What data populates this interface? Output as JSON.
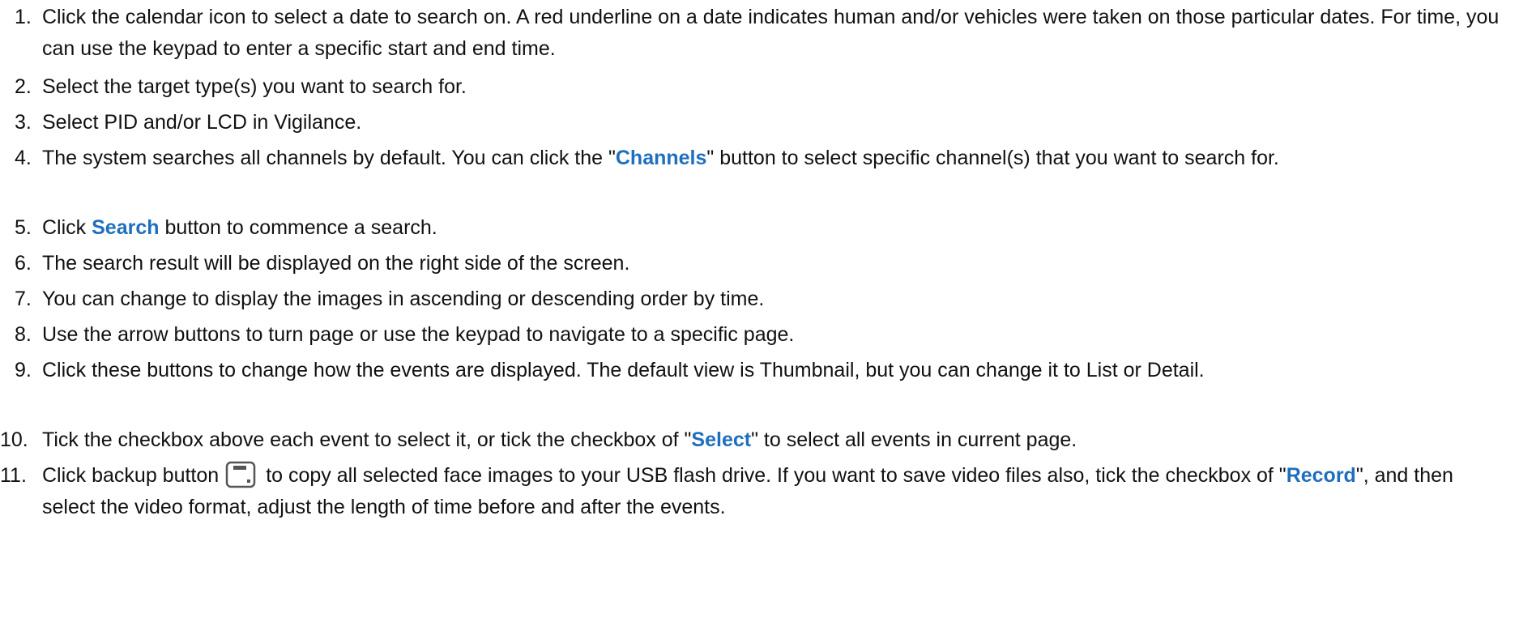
{
  "items": [
    {
      "num": "1.",
      "text": "Click the calendar icon to select a date to search on. A red underline on a date indicates human and/or vehicles were taken on those particular dates. For time, you can use the keypad to enter a specific start and end time."
    },
    {
      "num": "2.",
      "text": "Select the target type(s) you want to search for."
    },
    {
      "num": "3.",
      "text": "Select PID and/or LCD in Vigilance."
    },
    {
      "num": "4.",
      "pre": "The system searches all channels by default. You can click the \"",
      "kw": "Channels",
      "post": "\" button to select specific channel(s) that you want to search for."
    },
    {
      "num": "5.",
      "pre": "Click ",
      "kw": "Search",
      "post": " button to commence a search."
    },
    {
      "num": "6.",
      "text": "The search result will be displayed on the right side of the screen."
    },
    {
      "num": "7.",
      "text": "You can change to display the images in ascending or descending order by time."
    },
    {
      "num": "8.",
      "text": "Use the arrow buttons to turn page or use the keypad to navigate to a specific page."
    },
    {
      "num": "9.",
      "text": "Click these buttons to change how the events are displayed. The default view is Thumbnail, but you can change it to List or Detail."
    },
    {
      "num": "10.",
      "pre": "Tick the checkbox above each event to select it, or tick the checkbox of \"",
      "kw": "Select",
      "post": "\" to select all events in current page."
    },
    {
      "num": "11.",
      "pre": "Click backup button",
      "icon": "backup-save-icon",
      "mid": "to copy all selected face images to your USB flash drive. If you want to save video files also, tick the checkbox of \"",
      "kw": "Record",
      "post": "\", and then select the video format, adjust the length of time before and after the events."
    }
  ],
  "colors": {
    "keyword": "#1f6fbf",
    "text": "#111111"
  }
}
